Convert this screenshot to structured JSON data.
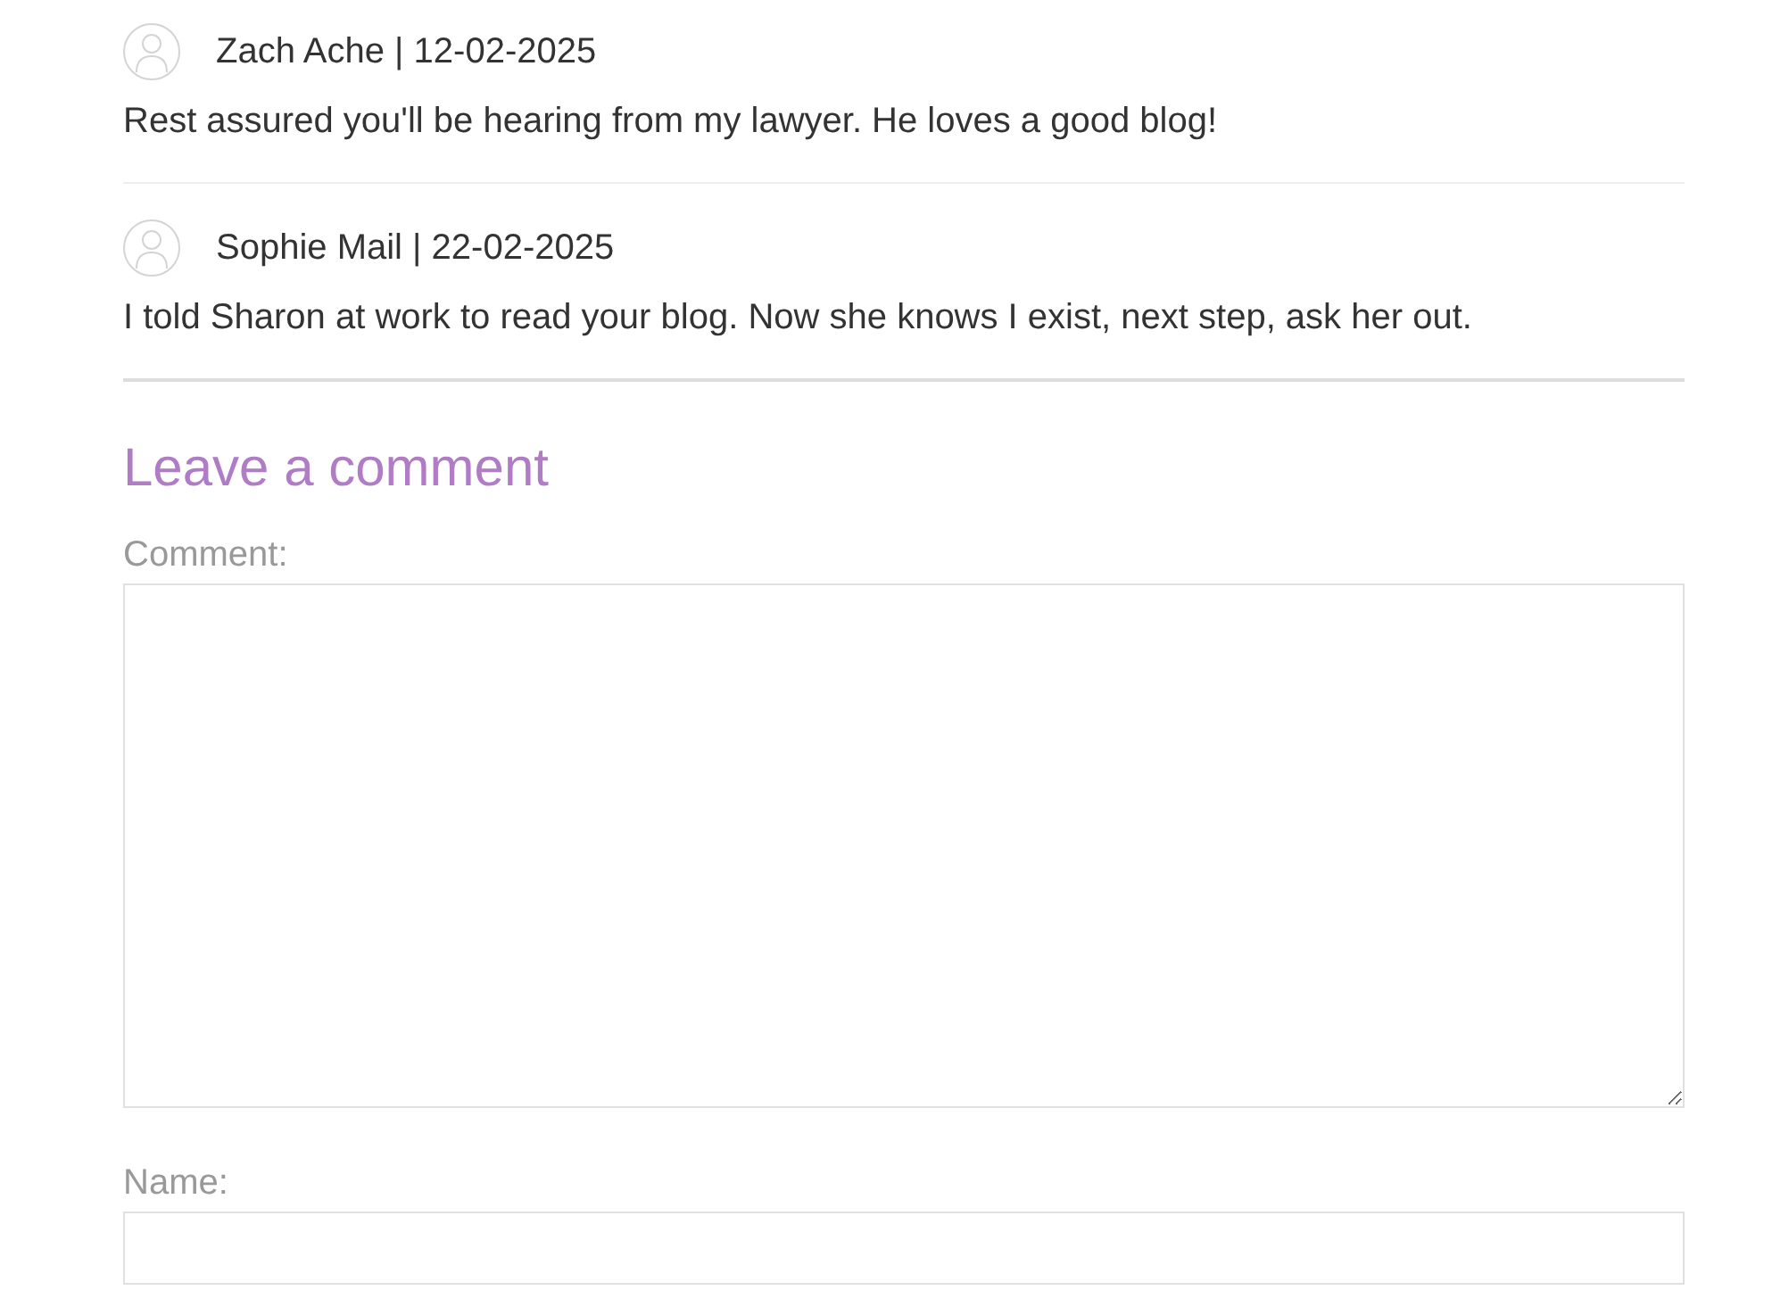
{
  "comments": [
    {
      "byline": "Zach Ache | 12-02-2025",
      "text": "Rest assured you'll be hearing from my lawyer. He loves a good blog!"
    },
    {
      "byline": "Sophie Mail | 22-02-2025",
      "text": "I told Sharon at work to read your blog. Now she knows I exist, next step, ask her out."
    }
  ],
  "comment_form": {
    "title": "Leave a comment",
    "fields": [
      {
        "kind": "textarea",
        "label": "Comment:"
      },
      {
        "kind": "input",
        "label": "Name:"
      }
    ]
  }
}
